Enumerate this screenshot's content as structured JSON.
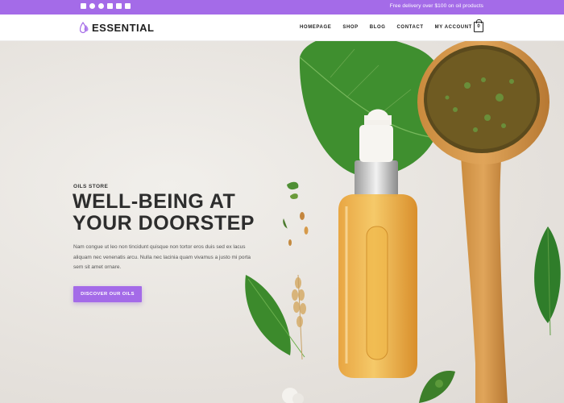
{
  "topbar": {
    "social_icons": [
      "email-icon",
      "facebook-icon",
      "pinterest-icon",
      "instagram-icon",
      "linkedin-icon",
      "rss-icon"
    ],
    "promo_text": "Free delivery over $100 on oil products",
    "color": "#a46be8"
  },
  "header": {
    "logo_text": "ESSENTIAL",
    "nav": [
      "HOMEPAGE",
      "SHOP",
      "BLOG",
      "CONTACT",
      "MY ACCOUNT"
    ],
    "cart_count": "0"
  },
  "hero": {
    "eyebrow": "OILS STORE",
    "headline": "WELL-BEING AT YOUR DOORSTEP",
    "body": "Nam congue ut leo non tincidunt quisque non tortor eros duis sed ex lacus aliquam nec venenatis arcu. Nulla nec lacinia quam vivamus a justo mi porta sem sit amet ornare.",
    "cta_label": "DISCOVER OUR OILS",
    "accent": "#a46be8"
  }
}
